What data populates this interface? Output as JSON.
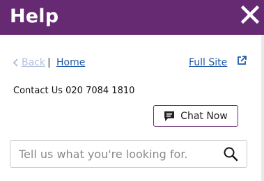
{
  "header": {
    "title": "Help",
    "close_icon": "close-icon",
    "background_color": "#662a73"
  },
  "nav": {
    "back_label": "Back",
    "separator": "|",
    "home_label": "Home",
    "full_site_label": "Full Site",
    "external_icon": "external-link-icon"
  },
  "contact": {
    "text": "Contact Us 020 7084 1810"
  },
  "chat": {
    "label": "Chat Now",
    "icon": "chat-bubble-icon"
  },
  "search": {
    "placeholder": "Tell us what you're looking for.",
    "value": "",
    "icon": "search-icon"
  }
}
